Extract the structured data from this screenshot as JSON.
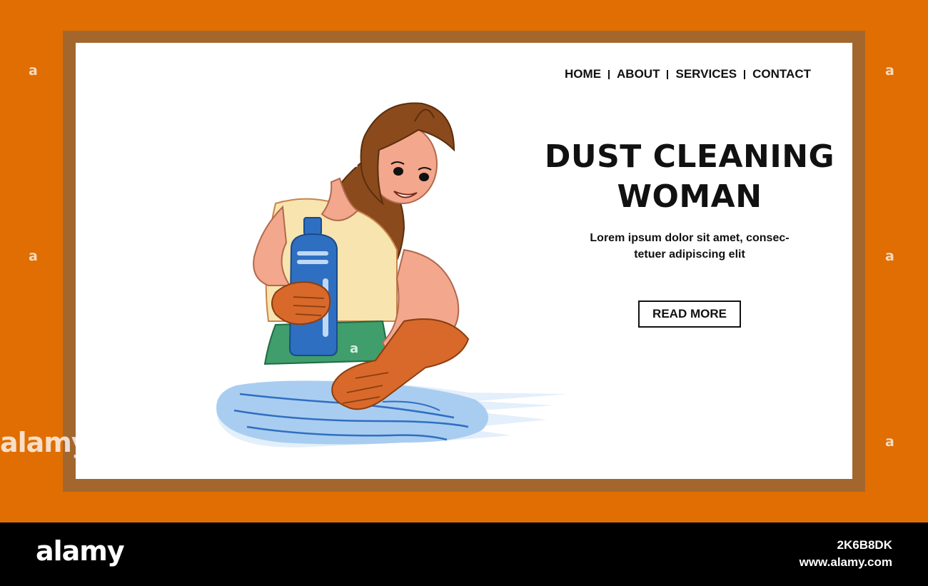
{
  "nav": {
    "items": [
      "HOME",
      "ABOUT",
      "SERVICES",
      "CONTACT"
    ]
  },
  "hero": {
    "title_line1": "DUST CLEANING",
    "title_line2": "WOMAN",
    "subtitle_line1": "Lorem ipsum dolor sit amet, consec-",
    "subtitle_line2": "tetuer adipiscing elit",
    "cta_label": "READ MORE"
  },
  "watermark": {
    "glyph": "a",
    "wordmark": "alamy"
  },
  "footer": {
    "logo": "alamy",
    "image_id": "2K6B8DK",
    "url": "www.alamy.com"
  },
  "colors": {
    "background_orange": "#E06E03",
    "frame_brown": "#A3672E",
    "glove": "#D8692A",
    "bottle": "#2F6FC1",
    "water": "#A9CDF0",
    "shirt": "#F8E4AF",
    "skirt": "#3F9E6B",
    "hair": "#8A4A1C",
    "skin": "#F3A78C"
  },
  "icons": [
    "woman-cleaning-illustration",
    "detergent-bottle-icon",
    "water-puddle-icon"
  ]
}
